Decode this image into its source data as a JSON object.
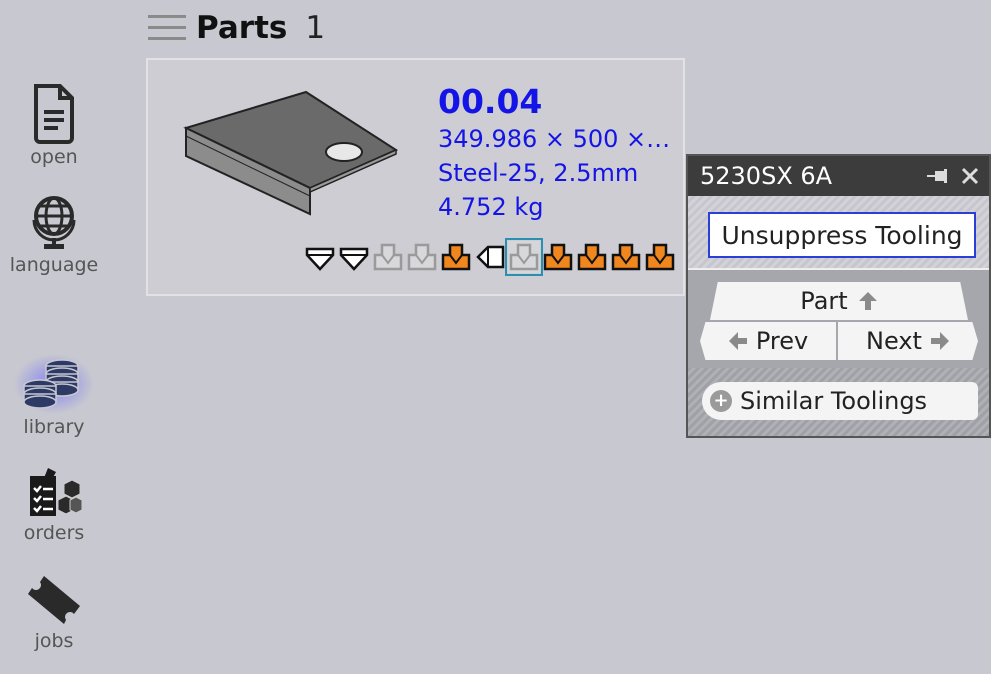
{
  "sidebar": {
    "items": [
      {
        "label": "open",
        "icon": "document-icon"
      },
      {
        "label": "language",
        "icon": "globe-icon"
      },
      {
        "label": "library",
        "icon": "coins-stack-icon",
        "active": true
      },
      {
        "label": "orders",
        "icon": "clipboard-boxes-icon"
      },
      {
        "label": "jobs",
        "icon": "ticket-icon"
      }
    ]
  },
  "header": {
    "title": "Parts",
    "count": "1"
  },
  "part": {
    "name": "00.04",
    "dimensions": "349.986 × 500 ×…",
    "material": "Steel-25, 2.5mm",
    "weight": "4.752 kg"
  },
  "tooling_strip": {
    "icons": [
      {
        "name": "punch-white-icon",
        "state": "outline"
      },
      {
        "name": "punch-white-icon",
        "state": "outline"
      },
      {
        "name": "die-grey-icon",
        "state": "suppressed"
      },
      {
        "name": "die-grey-icon",
        "state": "suppressed"
      },
      {
        "name": "die-orange-icon",
        "state": "active"
      },
      {
        "name": "side-tool-white-icon",
        "state": "outline"
      },
      {
        "name": "die-grey-icon",
        "state": "selected"
      },
      {
        "name": "die-orange-icon",
        "state": "active"
      },
      {
        "name": "die-orange-icon",
        "state": "active"
      },
      {
        "name": "die-orange-icon",
        "state": "active"
      },
      {
        "name": "die-orange-icon",
        "state": "active"
      }
    ]
  },
  "tool_panel": {
    "title": "5230SX 6A",
    "unsuppress_label": "Unsuppress Tooling",
    "part_label": "Part",
    "prev_label": "Prev",
    "next_label": "Next",
    "similar_label": "Similar Toolings"
  },
  "colors": {
    "background": "#c8c8d0",
    "part_text": "#1414e6",
    "orange": "#f0871e",
    "panel_header": "#3c3c3c",
    "selection": "#2a8fb0"
  }
}
